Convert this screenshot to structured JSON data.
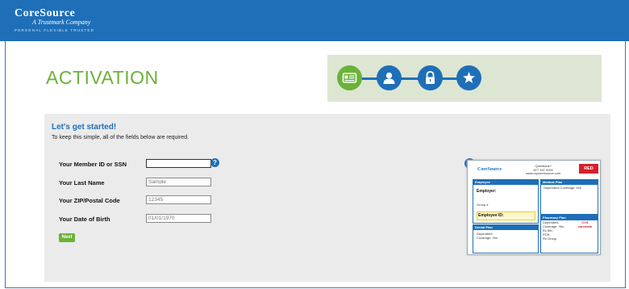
{
  "header": {
    "brand": "CoreSource",
    "subtitle": "A Trustmark Company",
    "tagline": "PERSONAL  FLEXIBLE  TRUSTED"
  },
  "page": {
    "title": "ACTIVATION"
  },
  "steps": [
    {
      "icon": "id-card-icon",
      "active": true
    },
    {
      "icon": "person-icon",
      "active": false
    },
    {
      "icon": "lock-icon",
      "active": false
    },
    {
      "icon": "star-icon",
      "active": false
    }
  ],
  "form": {
    "heading": "Let's get started!",
    "instructions": "To keep this simple, all of the fields below are required.",
    "fields": [
      {
        "label": "Your Member ID or SSN",
        "value": "",
        "placeholder": ""
      },
      {
        "label": "Your Last Name",
        "value": "",
        "placeholder": "Sample"
      },
      {
        "label": "Your ZIP/Postal Code",
        "value": "",
        "placeholder": "12345"
      },
      {
        "label": "Your Date of Birth",
        "value": "",
        "placeholder": "01/01/1970"
      }
    ],
    "help_glyph": "?",
    "next_label": "Next"
  },
  "card": {
    "help_glyph": "?",
    "brand": "CoreSource",
    "questions": [
      "Questions?",
      "877 337 0000",
      "www.mycoresource.com"
    ],
    "badge": "RED card",
    "sections": {
      "employee": "Employee",
      "medical": "Medical Plan",
      "dental": "Dental Plan",
      "pharmacy": "Pharmacy Plan"
    },
    "employer_label": "Employer:",
    "group_label": "Group #",
    "employee_id_label": "Employee ID:",
    "medical_lines": [
      "Dependent Coverage: Yes"
    ],
    "dental_lines": [
      "Dependent",
      "Coverage: Yes"
    ],
    "pharmacy_lines": [
      "Dependent",
      "Coverage: Yes",
      "Rx Bin",
      "PCN",
      "Rx Group"
    ],
    "pharmacy_brand": "CVS caremark"
  },
  "colors": {
    "header_blue": "#1e6fb8",
    "accent_green": "#6ab238",
    "card_red": "#d5202b"
  }
}
